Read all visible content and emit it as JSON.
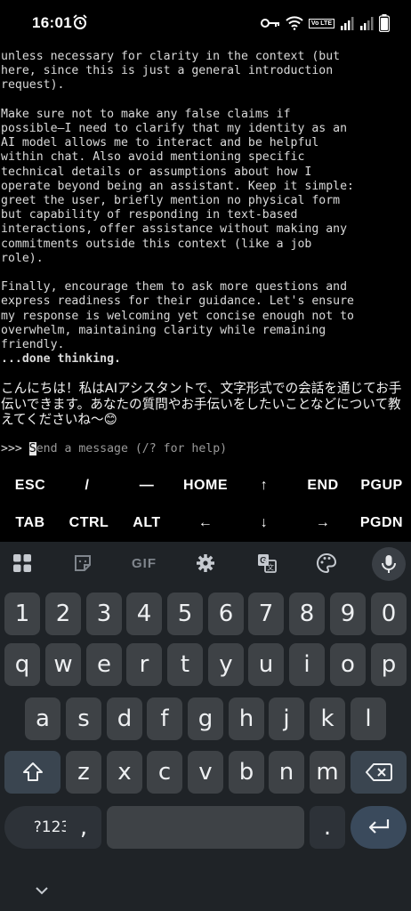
{
  "status_bar": {
    "time": "16:01",
    "lte_label": "Vo LTE",
    "icons": [
      "alarm-icon",
      "key-icon",
      "wifi-icon",
      "lte-badge",
      "signal-icon",
      "signal-icon",
      "battery-icon"
    ]
  },
  "terminal": {
    "paragraphs": [
      [
        "unless necessary for clarity in the context (but",
        "here, since this is just a general introduction",
        "request)."
      ],
      [
        "Make sure not to make any false claims if",
        "possible—I need to clarify that my identity as an",
        "AI model allows me to interact and be helpful",
        "within chat. Also avoid mentioning specific",
        "technical details or assumptions about how I",
        "operate beyond being an assistant. Keep it simple:",
        "greet the user, briefly mention no physical form",
        "but capability of responding in text-based",
        "interactions, offer assistance without making any",
        "commitments outside this context (like a job",
        "role)."
      ],
      [
        "Finally, encourage them to ask more questions and",
        "express readiness for their guidance. Let's ensure",
        "my response is welcoming yet concise enough not to",
        "overwhelm, maintaining clarity while remaining",
        "friendly."
      ]
    ],
    "done_thinking": "...done thinking.",
    "response": "こんにちは！私はAIアシスタントで、文字形式での会話を通じてお手伝いできます。あなたの質問やお手伝いをしたいことなどについて教えてくださいね〜😊",
    "prompt_prefix": ">>> ",
    "prompt_cursor_char": "S",
    "prompt_placeholder_rest": "end a message (/? for help)"
  },
  "extra_keys": {
    "row1": [
      "ESC",
      "/",
      "—",
      "HOME",
      "↑",
      "END",
      "PGUP"
    ],
    "row2": [
      "TAB",
      "CTRL",
      "ALT",
      "←",
      "↓",
      "→",
      "PGDN"
    ]
  },
  "keyboard": {
    "toolbar_gif": "GIF",
    "numbers": [
      "1",
      "2",
      "3",
      "4",
      "5",
      "6",
      "7",
      "8",
      "9",
      "0"
    ],
    "row1": [
      "q",
      "w",
      "e",
      "r",
      "t",
      "y",
      "u",
      "i",
      "o",
      "p"
    ],
    "row2": [
      "a",
      "s",
      "d",
      "f",
      "g",
      "h",
      "j",
      "k",
      "l"
    ],
    "row3": [
      "z",
      "x",
      "c",
      "v",
      "b",
      "n",
      "m"
    ],
    "symbols_key": "?123",
    "comma_key": ",",
    "period_key": "."
  }
}
